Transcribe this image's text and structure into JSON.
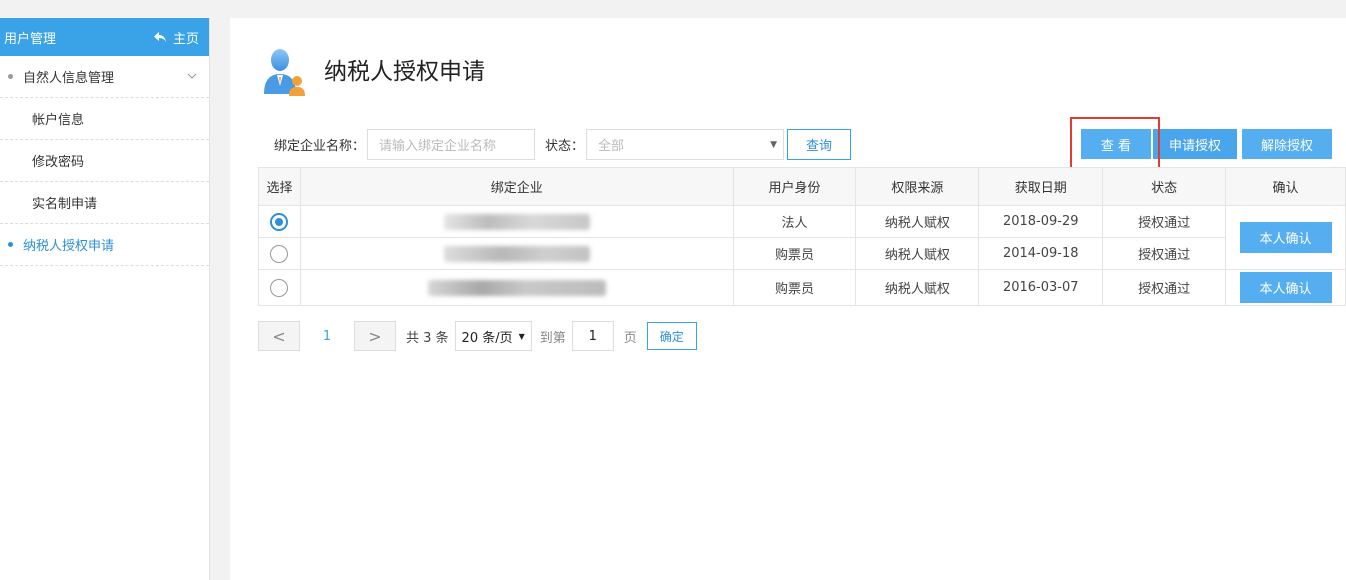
{
  "sidebar": {
    "title": "用户管理",
    "home_label": "主页",
    "items": [
      {
        "label": "自然人信息管理",
        "level": 1,
        "expandable": true,
        "active": false
      },
      {
        "label": "帐户信息",
        "level": 2,
        "active": false
      },
      {
        "label": "修改密码",
        "level": 2,
        "active": false
      },
      {
        "label": "实名制申请",
        "level": 2,
        "active": false
      },
      {
        "label": "纳税人授权申请",
        "level": 1,
        "active": true
      }
    ]
  },
  "page": {
    "title": "纳税人授权申请",
    "icon": "taxpayer-people-icon"
  },
  "filter": {
    "company_label": "绑定企业名称：",
    "company_placeholder": "请输入绑定企业名称",
    "status_label": "状态：",
    "status_value": "全部",
    "query_button": "查询"
  },
  "actions": {
    "view": "查 看",
    "apply": "申请授权",
    "remove": "解除授权"
  },
  "table": {
    "headers": [
      "选择",
      "绑定企业",
      "用户身份",
      "权限来源",
      "获取日期",
      "状态",
      "确认"
    ],
    "rows": [
      {
        "selected": true,
        "company": "",
        "identity": "法人",
        "source": "纳税人赋权",
        "date": "2018-09-29",
        "status": "授权通过",
        "confirm": "本人确认"
      },
      {
        "selected": false,
        "company": "",
        "identity": "购票员",
        "source": "纳税人赋权",
        "date": "2014-09-18",
        "status": "授权通过",
        "confirm": ""
      },
      {
        "selected": false,
        "company": "",
        "identity": "购票员",
        "source": "纳税人赋权",
        "date": "2016-03-07",
        "status": "授权通过",
        "confirm": "本人确认"
      }
    ]
  },
  "pagination": {
    "prev": "<",
    "current_page": "1",
    "next": ">",
    "total": "共 3 条",
    "page_size": "20 条/页",
    "goto_label": "到第",
    "goto_value": "1",
    "page_unit": "页",
    "confirm": "确定"
  },
  "colors": {
    "accent": "#3aa3e8",
    "button": "#55aef0",
    "highlight": "#e53935"
  }
}
